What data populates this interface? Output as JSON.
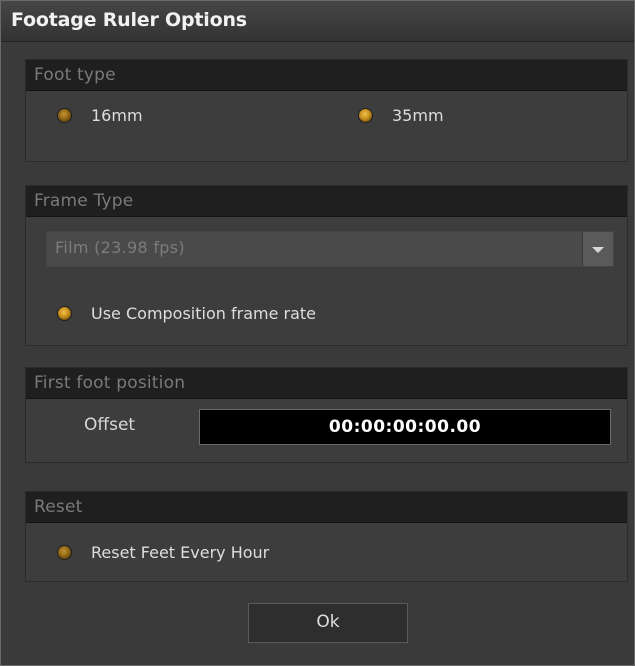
{
  "window": {
    "title": "Footage Ruler Options"
  },
  "foot_type": {
    "header": "Foot type",
    "options": [
      {
        "label": "16mm",
        "selected": false
      },
      {
        "label": "35mm",
        "selected": true
      }
    ]
  },
  "frame_type": {
    "header": "Frame Type",
    "dropdown_value": "Film  (23.98 fps)",
    "use_comp_label": "Use Composition frame rate",
    "use_comp_selected": true
  },
  "first_foot": {
    "header": "First foot position",
    "offset_label": "Offset",
    "offset_value": "00:00:00:00.00"
  },
  "reset": {
    "header": "Reset",
    "option_label": "Reset Feet Every Hour",
    "option_selected": false
  },
  "footer": {
    "ok_label": "Ok"
  },
  "colors": {
    "accent_radio": "#d99a20",
    "panel_bg": "#3b3b3b",
    "header_bg": "#1f1f1f"
  }
}
